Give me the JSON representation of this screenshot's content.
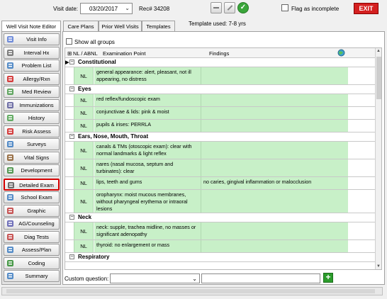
{
  "topbar": {
    "visit_date_label": "Visit date:",
    "visit_date": "03/20/2017",
    "rec_label": "Rec# 34208",
    "flag_label": "Flag as incomplete",
    "exit_label": "EXIT"
  },
  "left_tab": "Well Visit Note Editor",
  "nav": [
    {
      "label": "Visit Info",
      "icon": "visit-info-icon",
      "color": "#5a7bd6"
    },
    {
      "label": "Interval Hx",
      "icon": "interval-hx-icon",
      "color": "#6a6a6a"
    },
    {
      "label": "Problem List",
      "icon": "problem-list-icon",
      "color": "#3a7ac0"
    },
    {
      "label": "Allergy/Rxn",
      "icon": "allergy-icon",
      "color": "#d02020"
    },
    {
      "label": "Med Review",
      "icon": "med-review-icon",
      "color": "#4a9a4a"
    },
    {
      "label": "Immunizations",
      "icon": "syringe-icon",
      "color": "#5a5a9a"
    },
    {
      "label": "History",
      "icon": "history-icon",
      "color": "#4aa04a"
    },
    {
      "label": "Risk Assess",
      "icon": "risk-assess-icon",
      "color": "#d02020"
    },
    {
      "label": "Surveys",
      "icon": "survey-icon",
      "color": "#3a7ac0"
    },
    {
      "label": "Vital Signs",
      "icon": "vital-signs-icon",
      "color": "#8a5a2a"
    },
    {
      "label": "Development",
      "icon": "development-icon",
      "color": "#3a8a3a"
    },
    {
      "label": "Detailed Exam",
      "icon": "stethoscope-icon",
      "color": "#555555"
    },
    {
      "label": "School Exam",
      "icon": "school-exam-icon",
      "color": "#3a7ac0"
    },
    {
      "label": "Graphic",
      "icon": "graphic-icon",
      "color": "#c03a3a"
    },
    {
      "label": "AG/Counseling",
      "icon": "counseling-icon",
      "color": "#5a5ab0"
    },
    {
      "label": "Diag Tests",
      "icon": "diag-tests-icon",
      "color": "#c03a3a"
    },
    {
      "label": "Assess/Plan",
      "icon": "assess-plan-icon",
      "color": "#3a7ac0"
    },
    {
      "label": "Coding",
      "icon": "coding-icon",
      "color": "#2a8a2a"
    },
    {
      "label": "Summary",
      "icon": "summary-icon",
      "color": "#3a7ac0"
    }
  ],
  "active_nav": "Detailed Exam",
  "tabs": [
    "Care Plans",
    "Prior Well Visits",
    "Templates"
  ],
  "template_label": "Template used:  7-8 yrs",
  "show_all_label": "Show all groups",
  "grid": {
    "col_nl": "NL / ABNL",
    "col_exam": "Examination Point",
    "col_findings": "Findings"
  },
  "sections": [
    {
      "title": "Constitutional",
      "items": [
        {
          "nl": "NL",
          "exam": "general appearance: alert, pleasant, not ill appearing, no distress",
          "findings": ""
        }
      ]
    },
    {
      "title": "Eyes",
      "items": [
        {
          "nl": "NL",
          "exam": "red reflex/fundoscopic exam",
          "findings": ""
        },
        {
          "nl": "NL",
          "exam": "conjunctivae & lids: pink & moist",
          "findings": ""
        },
        {
          "nl": "NL",
          "exam": "pupils & irises: PERRLA",
          "findings": ""
        }
      ]
    },
    {
      "title": "Ears, Nose, Mouth, Throat",
      "items": [
        {
          "nl": "NL",
          "exam": "canals & TMs (otoscopic exam): clear with normal landmarks & light reflex",
          "findings": ""
        },
        {
          "nl": "NL",
          "exam": "nares (nasal mucosa, septum and turbinates): clear",
          "findings": ""
        },
        {
          "nl": "NL",
          "exam": "lips, teeth and gums",
          "findings": "no caries, gingival inflammation or malocclusion"
        },
        {
          "nl": "NL",
          "exam": "oropharynx: moist mucous membranes, without pharyngeal erythema or intraoral lesions",
          "findings": ""
        }
      ]
    },
    {
      "title": "Neck",
      "items": [
        {
          "nl": "NL",
          "exam": "neck: supple, trachea midline, no masses or significant adenopathy",
          "findings": ""
        },
        {
          "nl": "NL",
          "exam": "thyroid: no enlargement or mass",
          "findings": ""
        }
      ]
    },
    {
      "title": "Respiratory",
      "items": []
    }
  ],
  "custom_question_label": "Custom question:"
}
